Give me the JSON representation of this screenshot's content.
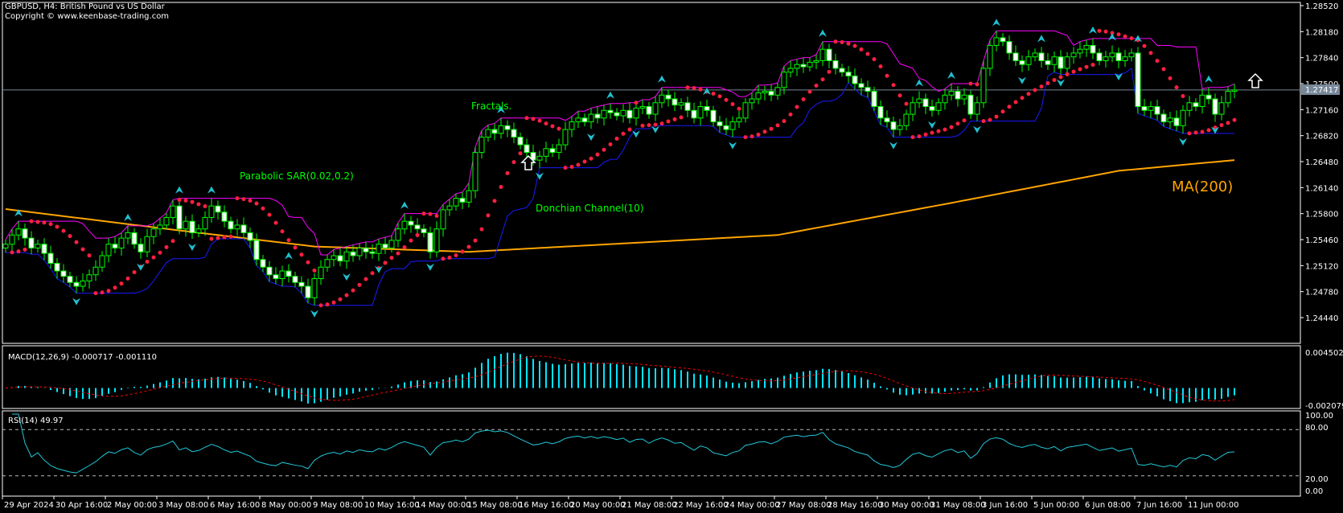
{
  "header": {
    "title": "GBPUSD, H4:  British Pound vs US Dollar",
    "copyright": "Copyright © www.keenbase-trading.com"
  },
  "annotations": {
    "sar": "Parabolic SAR(0.02,0.2)",
    "fractals": "Fractals.",
    "donchian": "Donchian Channel(10)",
    "ma": "MA(200)"
  },
  "icons": {
    "signal_arrows": "up-arrow-icon"
  },
  "colors": {
    "background": "#000000",
    "candle": "#00ff00",
    "sar": "#ff2040",
    "donchian_upper": "#ff00ff",
    "donchian_lower": "#1a1aff",
    "ma200": "#ffa500",
    "fractal": "#20c0d0",
    "macd_hist": "#00e5ff",
    "macd_signal": "#ff0000",
    "rsi": "#20c8d8",
    "current_price_box": "#778899"
  },
  "current_price": "1.27417",
  "macd": {
    "label": "MACD(12,26,9) -0.000717 -0.001110",
    "axis": [
      "0.004502",
      "-0.002079"
    ],
    "range": [
      -0.002079,
      0.004502
    ]
  },
  "rsi": {
    "label": "RSI(14) 49.97",
    "axis": [
      "100.00",
      "80.00",
      "20.00",
      "0.00"
    ],
    "levels": [
      80,
      20
    ]
  },
  "chart_data": {
    "type": "candlestick",
    "symbol": "GBPUSD",
    "timeframe": "H4",
    "ylim": [
      1.2444,
      1.2852
    ],
    "y_ticks": [
      "1.28520",
      "1.28180",
      "1.27840",
      "1.27500",
      "1.27160",
      "1.26820",
      "1.26480",
      "1.26140",
      "1.25800",
      "1.25460",
      "1.25120",
      "1.24780",
      "1.24440"
    ],
    "x_ticks": [
      "29 Apr 2024",
      "30 Apr 16:00",
      "2 May 00:00",
      "3 May 08:00",
      "6 May 16:00",
      "8 May 00:00",
      "9 May 08:00",
      "10 May 16:00",
      "14 May 00:00",
      "15 May 08:00",
      "16 May 16:00",
      "20 May 00:00",
      "21 May 08:00",
      "22 May 16:00",
      "24 May 00:00",
      "27 May 08:00",
      "28 May 16:00",
      "30 May 00:00",
      "31 May 08:00",
      "3 Jun 16:00",
      "5 Jun 00:00",
      "6 Jun 08:00",
      "7 Jun 16:00",
      "11 Jun 00:00"
    ],
    "bars_per_tick": 8,
    "closes": [
      1.254,
      1.2552,
      1.256,
      1.2548,
      1.2535,
      1.254,
      1.2528,
      1.2515,
      1.2505,
      1.2498,
      1.249,
      1.2485,
      1.2492,
      1.25,
      1.251,
      1.2525,
      1.254,
      1.2535,
      1.2548,
      1.2555,
      1.254,
      1.253,
      1.255,
      1.256,
      1.2565,
      1.2575,
      1.259,
      1.256,
      1.257,
      1.2555,
      1.256,
      1.2575,
      1.259,
      1.2582,
      1.257,
      1.256,
      1.2565,
      1.2555,
      1.2545,
      1.252,
      1.251,
      1.25,
      1.2495,
      1.2505,
      1.2498,
      1.249,
      1.2485,
      1.247,
      1.2495,
      1.251,
      1.252,
      1.2525,
      1.2518,
      1.253,
      1.2525,
      1.2535,
      1.253,
      1.2528,
      1.254,
      1.2535,
      1.2545,
      1.256,
      1.257,
      1.2565,
      1.256,
      1.2555,
      1.253,
      1.256,
      1.2585,
      1.259,
      1.26,
      1.2595,
      1.261,
      1.266,
      1.268,
      1.269,
      1.2685,
      1.2695,
      1.269,
      1.268,
      1.267,
      1.266,
      1.265,
      1.2655,
      1.2665,
      1.266,
      1.267,
      1.269,
      1.27,
      1.2705,
      1.27,
      1.271,
      1.2705,
      1.2715,
      1.2712,
      1.2708,
      1.2715,
      1.2705,
      1.2718,
      1.272,
      1.271,
      1.2725,
      1.2735,
      1.273,
      1.2722,
      1.2725,
      1.2715,
      1.2705,
      1.272,
      1.2715,
      1.27,
      1.2695,
      1.269,
      1.27,
      1.2705,
      1.2725,
      1.273,
      1.2738,
      1.274,
      1.2735,
      1.2745,
      1.2765,
      1.277,
      1.2775,
      1.2772,
      1.2778,
      1.278,
      1.2795,
      1.278,
      1.277,
      1.2765,
      1.276,
      1.275,
      1.2745,
      1.274,
      1.272,
      1.2705,
      1.27,
      1.269,
      1.2695,
      1.271,
      1.2725,
      1.273,
      1.272,
      1.2715,
      1.2725,
      1.2735,
      1.274,
      1.273,
      1.2735,
      1.271,
      1.2725,
      1.277,
      1.28,
      1.281,
      1.2805,
      1.279,
      1.278,
      1.2775,
      1.2785,
      1.279,
      1.278,
      1.2775,
      1.2785,
      1.277,
      1.2785,
      1.279,
      1.2795,
      1.28,
      1.279,
      1.278,
      1.2785,
      1.279,
      1.278,
      1.2785,
      1.279,
      1.272,
      1.2715,
      1.272,
      1.271,
      1.27,
      1.2705,
      1.2695,
      1.2715,
      1.2725,
      1.272,
      1.2735,
      1.273,
      1.271,
      1.2725,
      1.274,
      1.27417
    ],
    "ma200": [
      {
        "bar": 0,
        "value": 1.2586
      },
      {
        "bar": 27,
        "value": 1.2558
      },
      {
        "bar": 48,
        "value": 1.2537
      },
      {
        "bar": 72,
        "value": 1.253
      },
      {
        "bar": 120,
        "value": 1.2552
      },
      {
        "bar": 147,
        "value": 1.2594
      },
      {
        "bar": 173,
        "value": 1.2636
      },
      {
        "bar": 191,
        "value": 1.265
      }
    ],
    "signal_arrow_bars": [
      82,
      195
    ]
  }
}
